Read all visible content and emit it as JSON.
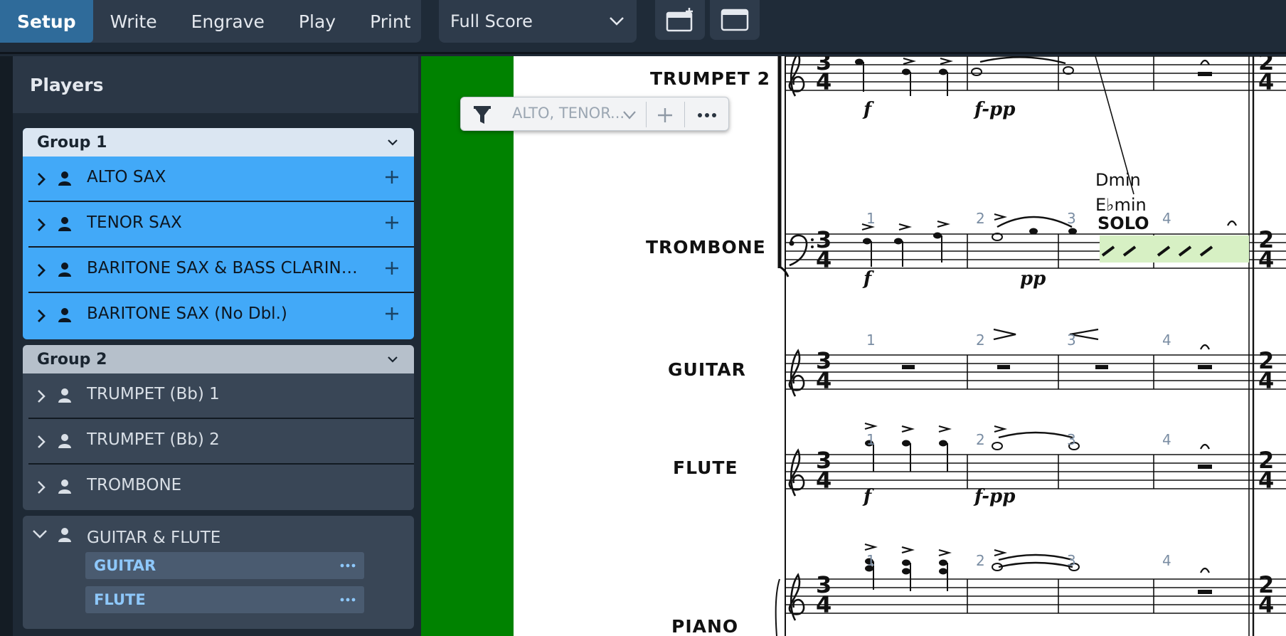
{
  "toolbar": {
    "modes": [
      "Setup",
      "Write",
      "Engrave",
      "Play",
      "Print"
    ],
    "active_mode": "Setup",
    "layout_select": "Full Score"
  },
  "players_panel": {
    "title": "Players",
    "groups": [
      {
        "name": "Group 1",
        "players": [
          "ALTO SAX",
          "TENOR SAX",
          "BARITONE SAX & BASS CLARINET (Dbl.)",
          "BARITONE SAX (No Dbl.)"
        ]
      },
      {
        "name": "Group 2",
        "players": [
          "TRUMPET (Bb) 1",
          "TRUMPET (Bb) 2",
          "TROMBONE"
        ]
      }
    ],
    "expanded_player": {
      "name": "GUITAR & FLUTE",
      "instruments": [
        "GUITAR",
        "FLUTE"
      ]
    }
  },
  "filter": {
    "selection": "ALTO, TENOR..."
  },
  "score": {
    "staff_names": [
      "TRUMPET 2",
      "TROMBONE",
      "GUITAR",
      "FLUTE",
      "PIANO"
    ],
    "bar_numbers": [
      "1",
      "2",
      "3",
      "4"
    ],
    "chord_top": "Dmin",
    "chord_bottom": "E♭min",
    "solo": "SOLO",
    "dyn_f": "f",
    "dyn_fpp": "f-pp",
    "dyn_pp": "pp"
  },
  "colors": {
    "selected_player": "#42a9f8",
    "active_mode": "#2f6b9a",
    "galley_margin": "#008200",
    "selection_highlight": "#d7f0c4"
  }
}
